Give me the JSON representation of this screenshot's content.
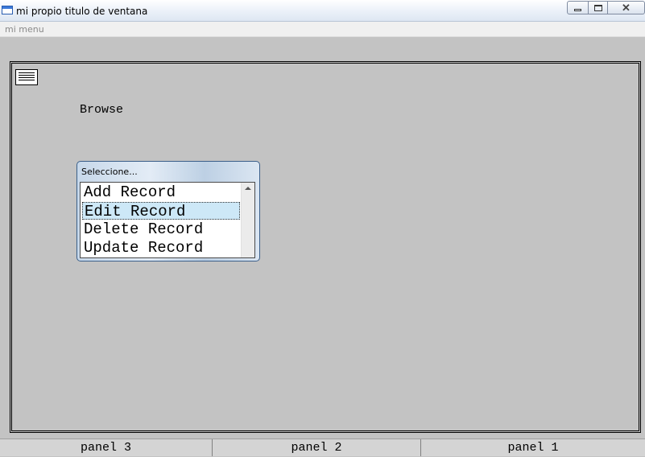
{
  "window": {
    "title": "mi propio titulo de ventana"
  },
  "menu": {
    "items": [
      "mi menu"
    ]
  },
  "main": {
    "label": "Browse"
  },
  "dialog": {
    "title": "Seleccione...",
    "items": [
      "Add Record",
      "Edit Record",
      "Delete Record",
      "Update Record"
    ],
    "selected": "Edit Record"
  },
  "status": {
    "panels": [
      "panel 3",
      "panel 2",
      "panel 1"
    ]
  },
  "icons": {
    "app": "window-icon",
    "document": "printer-icon"
  },
  "colors": {
    "selection": "#cde8f7",
    "background": "#c3c3c3"
  }
}
